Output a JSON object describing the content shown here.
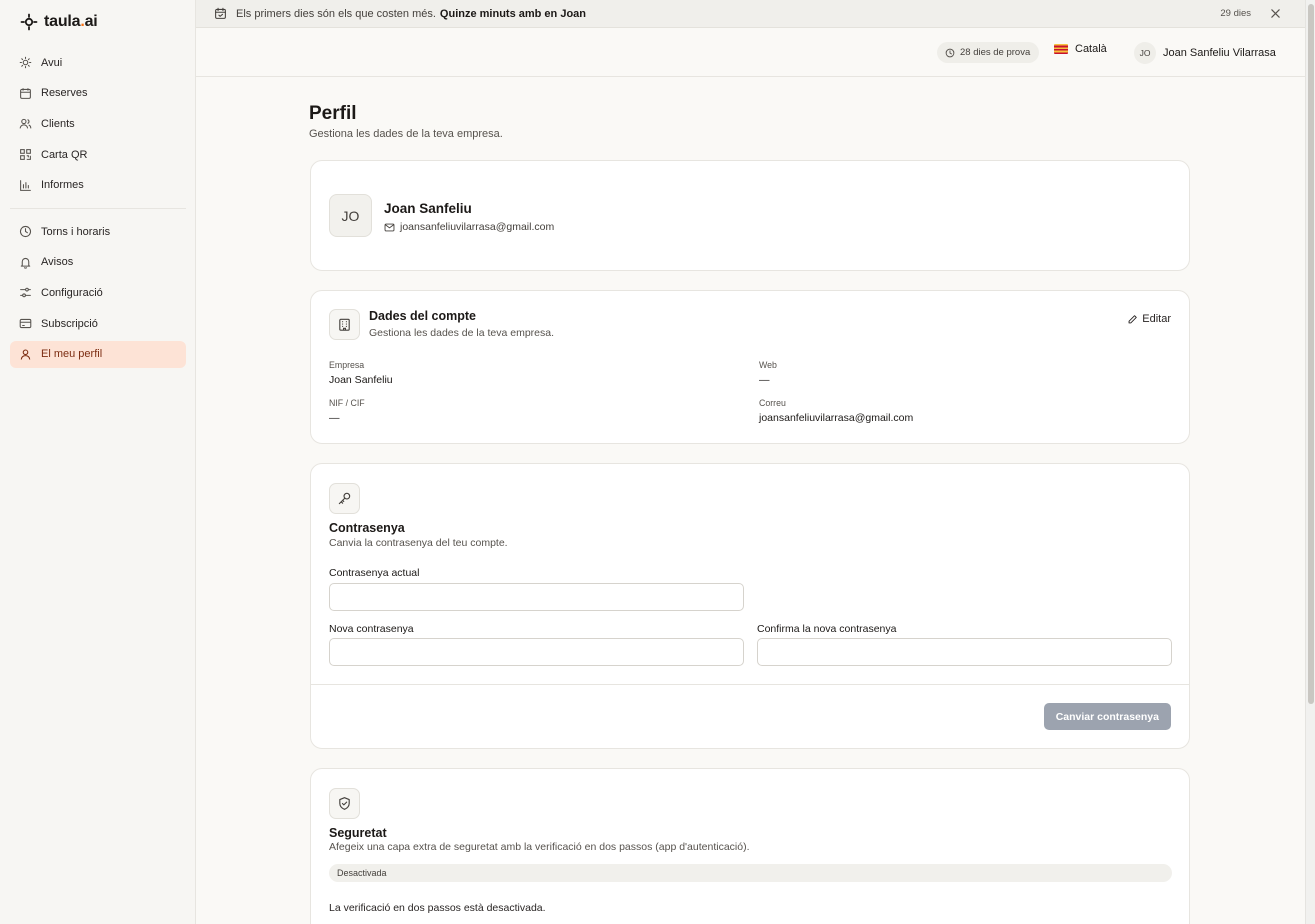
{
  "brand": {
    "name_main": "taula",
    "name_dot": ".",
    "name_tld": "ai"
  },
  "banner": {
    "text": "Els primers dies són els que costen més.",
    "bold": "Quinze minuts amb en Joan",
    "days": "29 dies"
  },
  "sidebar": {
    "items": [
      {
        "label": "Avui",
        "icon": "sun-icon"
      },
      {
        "label": "Reserves",
        "icon": "calendar-icon"
      },
      {
        "label": "Clients",
        "icon": "users-icon"
      },
      {
        "label": "Carta QR",
        "icon": "qr-code-icon"
      },
      {
        "label": "Informes",
        "icon": "bar-chart-icon"
      },
      {
        "label": "Torns i horaris",
        "icon": "clock-icon"
      },
      {
        "label": "Avisos",
        "icon": "bell-icon"
      },
      {
        "label": "Configuració",
        "icon": "settings-sliders-icon"
      },
      {
        "label": "Subscripció",
        "icon": "credit-card-icon"
      },
      {
        "label": "El meu perfil",
        "icon": "user-icon"
      }
    ]
  },
  "topbar": {
    "trial": "28 dies de prova",
    "language": "Català",
    "user_initials": "JO",
    "user_name": "Joan Sanfeliu Vilarrasa"
  },
  "page": {
    "title": "Perfil",
    "subtitle": "Gestiona les dades de la teva empresa."
  },
  "profile": {
    "initials": "JO",
    "name": "Joan Sanfeliu",
    "email": "joansanfeliuvilarrasa@gmail.com"
  },
  "account": {
    "title": "Dades del compte",
    "subtitle": "Gestiona les dades de la teva empresa.",
    "edit_label": "Editar",
    "fields": {
      "company_label": "Empresa",
      "company_value": "Joan Sanfeliu",
      "web_label": "Web",
      "web_value": "—",
      "nif_label": "NIF / CIF",
      "nif_value": "—",
      "email_label": "Correu",
      "email_value": "joansanfeliuvilarrasa@gmail.com"
    }
  },
  "password": {
    "title": "Contrasenya",
    "subtitle": "Canvia la contrasenya del teu compte.",
    "current_label": "Contrasenya actual",
    "current_value": "",
    "new_label": "Nova contrasenya",
    "new_value": "",
    "confirm_label": "Confirma la nova contrasenya",
    "confirm_value": "",
    "submit_label": "Canviar contrasenya"
  },
  "security": {
    "title": "Seguretat",
    "subtitle": "Afegeix una capa extra de seguretat amb la verificació en dos passos (app d'autenticació).",
    "status_badge": "Desactivada",
    "status_text": "La verificació en dos passos està desactivada."
  },
  "colors": {
    "accent": "#f97316",
    "active_bg": "#fde3d6",
    "disabled_button": "#9ca3af"
  }
}
